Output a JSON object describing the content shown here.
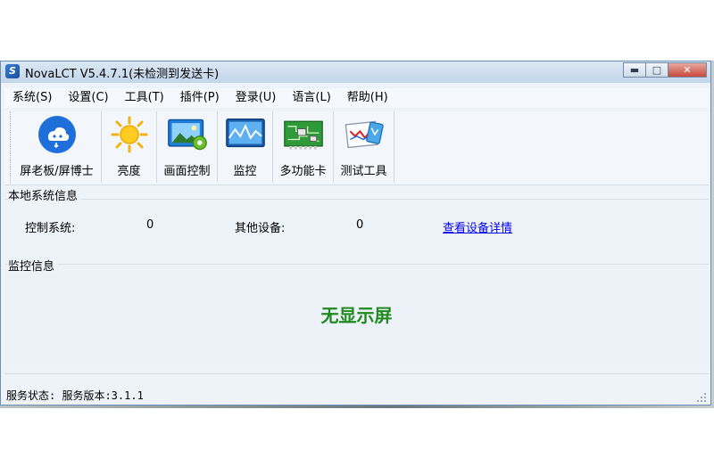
{
  "window": {
    "title": "NovaLCT V5.4.7.1(未检测到发送卡)"
  },
  "menu": [
    "系统(S)",
    "设置(C)",
    "工具(T)",
    "插件(P)",
    "登录(U)",
    "语言(L)",
    "帮助(H)"
  ],
  "toolbar": {
    "items": [
      {
        "label": "屏老板/屏博士",
        "icon": "cloud-bot-icon"
      },
      {
        "label": "亮度",
        "icon": "sun-icon"
      },
      {
        "label": "画面控制",
        "icon": "image-settings-icon"
      },
      {
        "label": "监控",
        "icon": "monitor-wave-icon"
      },
      {
        "label": "多功能卡",
        "icon": "circuit-board-icon"
      },
      {
        "label": "测试工具",
        "icon": "test-chart-icon"
      }
    ]
  },
  "local_info": {
    "heading": "本地系统信息",
    "control_label": "控制系统:",
    "control_value": "0",
    "other_label": "其他设备:",
    "other_value": "0",
    "details_link": "查看设备详情"
  },
  "monitor": {
    "heading": "监控信息",
    "message": "无显示屏"
  },
  "status": {
    "text": "服务状态: 服务版本:3.1.1"
  },
  "colors": {
    "message_green": "#1f8a1f",
    "link_blue": "#0000ee",
    "window_bg": "#eef3f9"
  }
}
